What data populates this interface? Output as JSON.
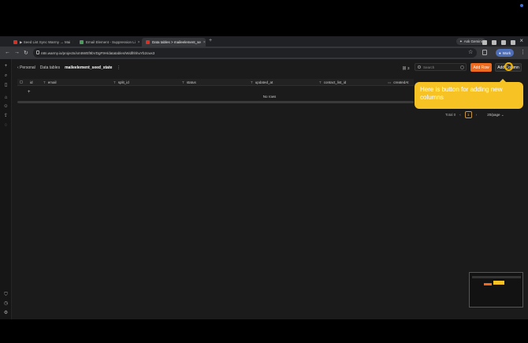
{
  "tabs": [
    {
      "title": "▶ Seed List Sync Warmy → Mai",
      "color": "#d93025",
      "active": false
    },
    {
      "title": "Email Element - Suppression Li",
      "color": "#4a9c5d",
      "active": false
    },
    {
      "title": "Data tables > maileelement_se",
      "color": "#d93025",
      "active": true
    }
  ],
  "browser": {
    "gemini_label": "Ask Gemini",
    "url": "n8n.warmy.io/projects/xm5WEf9bVDgF9H/datatables/WidlhhhuYb2cwx3",
    "profile_label": "Work"
  },
  "breadcrumbs": {
    "root": "Personal",
    "section": "Data tables",
    "current": "maileelement_seed_state"
  },
  "toolbar": {
    "link_count": "3",
    "search_placeholder": "Search",
    "add_row_label": "Add Row",
    "add_column_label": "Add Column"
  },
  "columns": [
    {
      "name": "id",
      "type": ""
    },
    {
      "name": "email",
      "type": "T"
    },
    {
      "name": "split_id",
      "type": "T"
    },
    {
      "name": "status",
      "type": "T"
    },
    {
      "name": "updated_at",
      "type": "T"
    },
    {
      "name": "contact_list_id",
      "type": "T"
    },
    {
      "name": "createdAt",
      "type": "▭"
    }
  ],
  "table": {
    "add_row_glyph": "+",
    "empty_text": "No rows"
  },
  "pagination": {
    "total": "Total 0",
    "prev": "‹",
    "page": "1",
    "next": "›",
    "per_page": "20/page"
  },
  "tooltip": {
    "text": "Here is button for adding new columns"
  },
  "colors": {
    "accent": "#ee6a1f",
    "tooltip": "#f7c324"
  }
}
